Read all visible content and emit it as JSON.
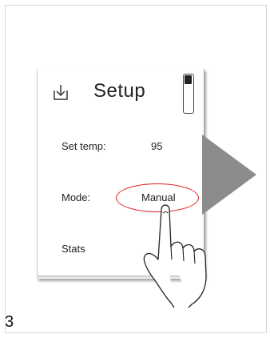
{
  "step_number": "3",
  "device": {
    "header": {
      "title": "Setup",
      "download_icon": "download-icon",
      "battery_icon": "battery-icon",
      "battery_level": 0.25
    },
    "rows": [
      {
        "label": "Set temp:",
        "value": "95"
      },
      {
        "label": "Mode:",
        "value": "Manual",
        "highlighted": true
      },
      {
        "label": "Stats",
        "value": ""
      }
    ]
  },
  "navigation_arrow": "right-arrow-icon",
  "pointer": "hand-pointer-icon",
  "colors": {
    "highlight": "#e01b1b",
    "arrow": "#8c8c8c",
    "frame_border": "#d6d6d6"
  }
}
